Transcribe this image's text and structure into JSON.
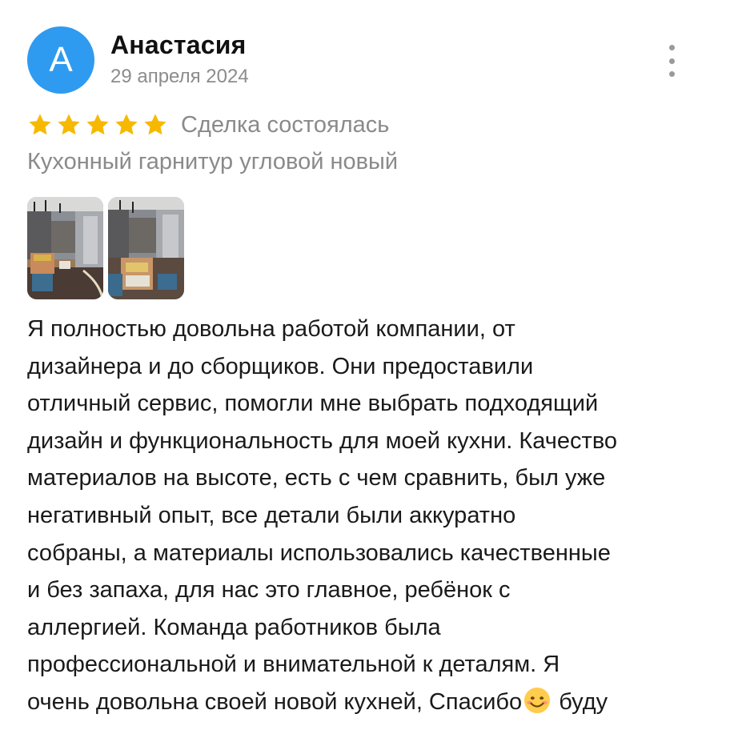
{
  "review": {
    "author": {
      "initial": "А",
      "name": "Анастасия",
      "date": "29 апреля 2024",
      "avatar_color": "#2f9bf0"
    },
    "menu_icon": "more-vertical-icon",
    "rating": {
      "stars": 5,
      "max": 5,
      "star_color": "#f6b900",
      "deal_status": "Сделка состоялась"
    },
    "product": "Кухонный гарнитур угловой новый",
    "photos": [
      {
        "label": "kitchen-photo-1"
      },
      {
        "label": "kitchen-photo-2"
      }
    ],
    "text_lines": [
      "Я полностью довольна работой компании, от",
      "дизайнера и до сборщиков. Они предоставили",
      "отличный сервис, помогли мне выбрать подходящий",
      "дизайн и функциональность для моей кухни. Качество",
      "материалов на высоте, есть с чем сравнить, был уже",
      "негативный опыт, все детали были аккуратно",
      "собраны, а материалы использовались качественные",
      "и без запаха, для нас это главное, ребёнок с",
      "аллергией. Команда работников была",
      "профессиональной и внимательной к деталям. Я"
    ],
    "last_line_before_emoji": "очень довольна своей новой кухней, Спасибо",
    "emoji": "smiling-face-emoji",
    "last_line_after_emoji": " буду"
  }
}
